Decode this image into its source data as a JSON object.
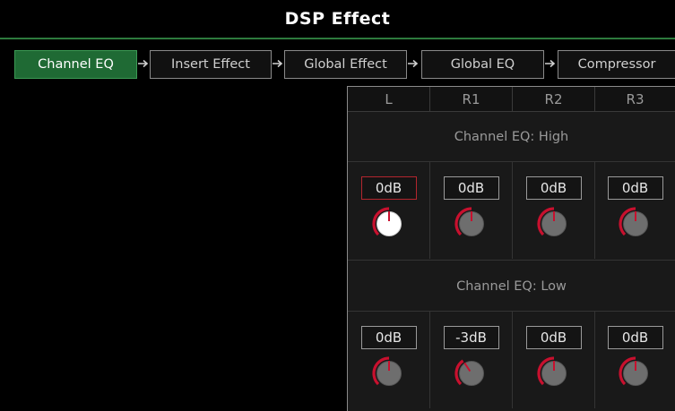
{
  "title": "DSP Effect",
  "steps": [
    {
      "label": "Channel EQ",
      "active": true
    },
    {
      "label": "Insert Effect",
      "active": false
    },
    {
      "label": "Global Effect",
      "active": false
    },
    {
      "label": "Global EQ",
      "active": false
    },
    {
      "label": "Compressor",
      "active": false
    }
  ],
  "columns": [
    "L",
    "R1",
    "R2",
    "R3"
  ],
  "sections": [
    {
      "title": "Channel EQ: High",
      "values": [
        "0dB",
        "0dB",
        "0dB",
        "0dB"
      ],
      "knob_levels": [
        0,
        0,
        0,
        0
      ],
      "selected_index": 0
    },
    {
      "title": "Channel EQ: Low",
      "values": [
        "0dB",
        "-3dB",
        "0dB",
        "0dB"
      ],
      "knob_levels": [
        0,
        -3,
        0,
        0
      ],
      "selected_index": -1
    }
  ],
  "colors": {
    "accent_green": "#1f6a34",
    "knob_ring_red": "#c8102e",
    "selected_knob_face": "#ffffff",
    "knob_face": "#6e6e6e"
  }
}
